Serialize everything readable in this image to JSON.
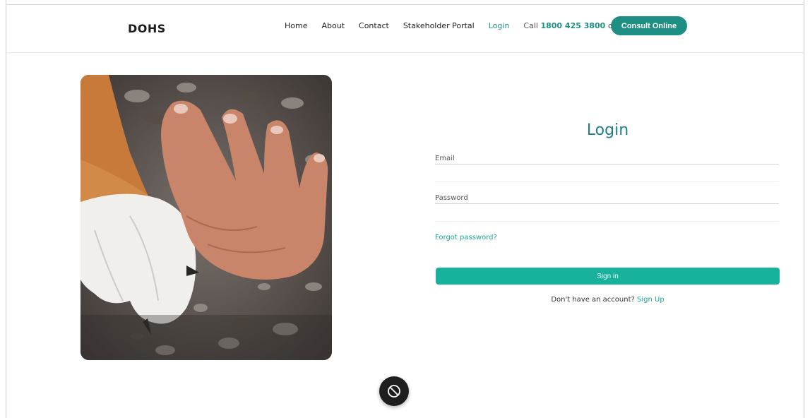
{
  "header": {
    "brand": "DOHS",
    "nav": [
      "Home",
      "About",
      "Contact",
      "Stakeholder Portal",
      "Login"
    ],
    "call_prefix": "Call",
    "phone": "1800 425 3800",
    "call_suffix": "or",
    "consult_button": "Consult Online"
  },
  "login": {
    "title": "Login",
    "email_label": "Email",
    "password_label": "Password",
    "forgot_link": "Forgot password?",
    "signin_button": "Sign in",
    "no_account_text": "Don't have an account?",
    "signup_link": "Sign Up"
  },
  "colors": {
    "accent": "#1f8f84",
    "button": "#18b19b",
    "title": "#1f7f86"
  },
  "icons": {
    "floating": "block-icon"
  }
}
